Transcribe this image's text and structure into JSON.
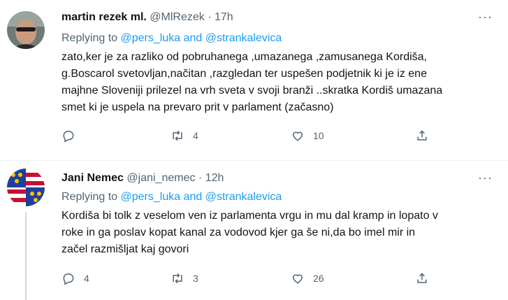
{
  "tweets": [
    {
      "name": "martin rezek ml.",
      "handle": "@MlRezek",
      "dot": "·",
      "time": "17h",
      "replying_prefix": "Replying to",
      "replying_mentions": "@pers_luka and @strankalevica",
      "lines": [
        "zato,ker je za razliko od pobruhanega ,umazanega ,zamusanega Kordiša,",
        "g.Boscarol svetovljan,načitan ,razgledan ter uspešen podjetnik ki je iz ene",
        "majhne Sloveniji prilezel na vrh sveta v svoji branži ..skratka Kordiš umazana",
        "smet ki je uspela na prevaro prit v parlament (začasno)"
      ],
      "replies": "",
      "retweets": "4",
      "likes": "10",
      "more": "···"
    },
    {
      "name": "Jani Nemec",
      "handle": "@jani_nemec",
      "dot": "·",
      "time": "12h",
      "replying_prefix": "Replying to",
      "replying_mentions": "@pers_luka and @strankalevica",
      "lines": [
        "Kordiša bi tolk z veselom ven iz parlamenta vrgu in mu dal kramp in lopato v",
        "roke in ga poslav kopat kanal za vodovod kjer ga še ni,da bo imel mir in",
        "začel razmišljat kaj govori"
      ],
      "replies": "4",
      "retweets": "3",
      "likes": "26",
      "more": "···"
    }
  ],
  "colors": {
    "link": "#1d9bf0",
    "secondary": "#536471",
    "text": "#0f1419"
  },
  "icons": [
    "reply-icon",
    "retweet-icon",
    "like-icon",
    "share-icon",
    "more-icon"
  ]
}
